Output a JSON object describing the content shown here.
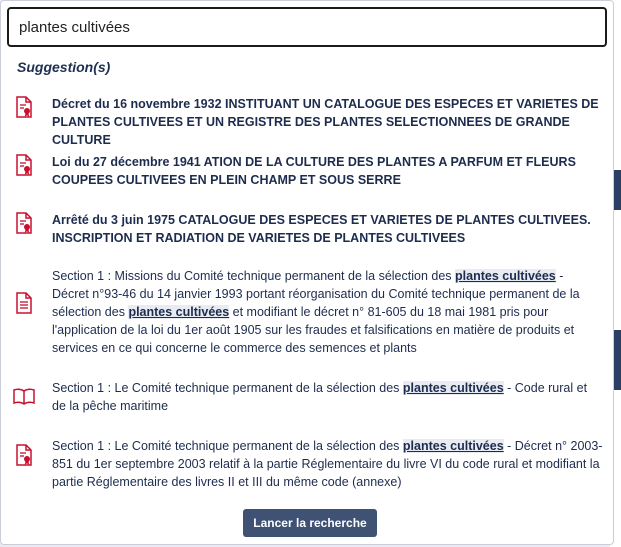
{
  "search": {
    "value": "plantes cultivées"
  },
  "suggestions_title": "Suggestion(s)",
  "items": [
    {
      "icon": "document-stamp-icon",
      "parts": [
        "Décret du 16 novembre 1932 INSTITUANT UN CATALOGUE DES ESPECES ET VARIETES DE PLANTES CULTIVEES ET UN REGISTRE DES PLANTES SELECTIONNEES DE GRANDE CULTURE"
      ]
    },
    {
      "icon": "document-stamp-icon",
      "parts": [
        "Loi du 27 décembre 1941 ATION DE LA CULTURE DES PLANTES A PARFUM ET FLEURS COUPEES CULTIVEES EN PLEIN CHAMP ET SOUS SERRE"
      ]
    },
    {
      "icon": "document-stamp-icon",
      "parts": [
        "Arrêté du 3 juin 1975 CATALOGUE DES ESPECES ET VARIETES DE PLANTES CULTIVEES. INSCRIPTION ET RADIATION DE VARIETES DE PLANTES CULTIVEES"
      ]
    },
    {
      "icon": "document-lines-icon",
      "parts": [
        "Section 1 : Missions du Comité technique permanent de la sélection des ",
        "plantes cultivées",
        " - Décret n°93-46 du 14 janvier 1993 portant réorganisation du Comité technique permanent de la sélection des ",
        "plantes cultivées",
        " et modifiant le décret n° 81-605 du 18 mai 1981 pris pour l'application de la loi du 1er août 1905 sur les fraudes et falsifications en matière de produits et services en ce qui concerne le commerce des semences et plants"
      ]
    },
    {
      "icon": "open-book-icon",
      "parts": [
        "Section 1 : Le Comité technique permanent de la sélection des ",
        "plantes cultivées",
        " - Code rural et de la pêche maritime"
      ]
    },
    {
      "icon": "document-stamp-icon",
      "parts": [
        "Section 1 : Le Comité technique permanent de la sélection des ",
        "plantes cultivées",
        " - Décret n° 2003-851 du 1er septembre 2003 relatif à la partie Réglementaire du livre VI du code rural et modifiant la partie Réglementaire des livres II et III du même code (annexe)"
      ]
    }
  ],
  "launch_label": "Lancer la recherche",
  "colors": {
    "icon_red": "#c8102e",
    "button_bg": "#3f5274",
    "highlight_bg": "#e8ebf1"
  }
}
